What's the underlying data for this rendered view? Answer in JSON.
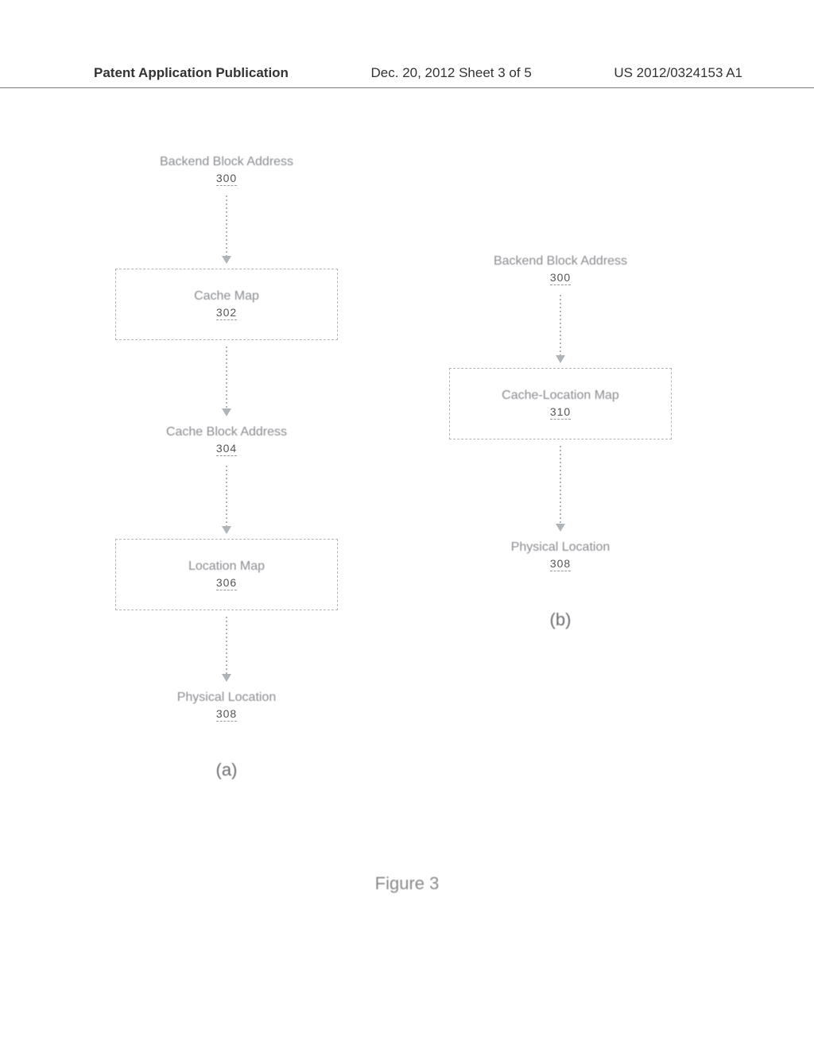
{
  "header": {
    "left": "Patent Application Publication",
    "mid": "Dec. 20, 2012  Sheet 3 of 5",
    "right": "US 2012/0324153 A1"
  },
  "figure_caption": "Figure 3",
  "flow_a": {
    "sublabel": "(a)",
    "steps": [
      {
        "kind": "label",
        "title": "Backend Block Address",
        "ref": "300"
      },
      {
        "kind": "arrow",
        "len": 90
      },
      {
        "kind": "box",
        "title": "Cache Map",
        "ref": "302"
      },
      {
        "kind": "arrow",
        "len": 92
      },
      {
        "kind": "label",
        "title": "Cache Block Address",
        "ref": "304"
      },
      {
        "kind": "arrow",
        "len": 90
      },
      {
        "kind": "box",
        "title": "Location Map",
        "ref": "306"
      },
      {
        "kind": "arrow",
        "len": 86
      },
      {
        "kind": "label",
        "title": "Physical Location",
        "ref": "308"
      }
    ]
  },
  "flow_b": {
    "sublabel": "(b)",
    "steps": [
      {
        "kind": "label",
        "title": "Backend Block Address",
        "ref": "300"
      },
      {
        "kind": "arrow",
        "len": 90
      },
      {
        "kind": "box",
        "title": "Cache-Location Map",
        "ref": "310"
      },
      {
        "kind": "arrow",
        "len": 112
      },
      {
        "kind": "label",
        "title": "Physical Location",
        "ref": "308"
      }
    ]
  }
}
